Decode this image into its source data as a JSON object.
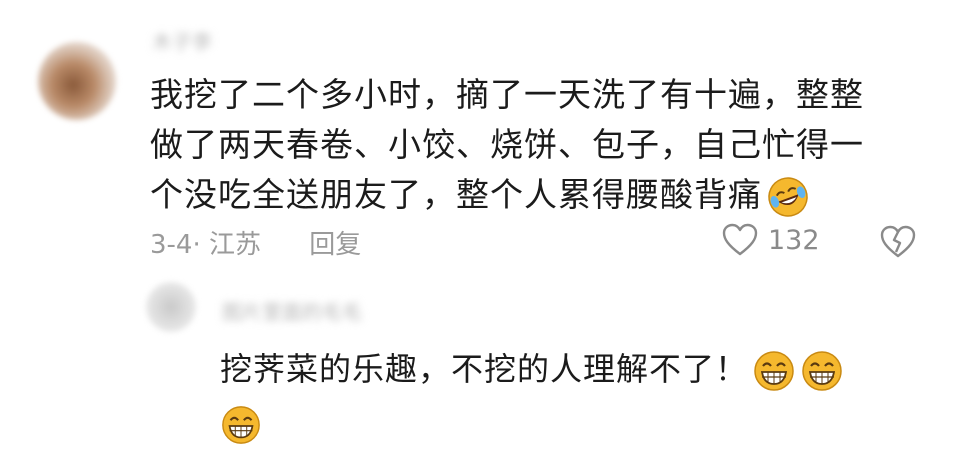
{
  "comment": {
    "author_name": "木子李",
    "text_lines": [
      "我挖了二个多小时，摘了一天洗了有十遍，整整",
      "做了两天春卷、小饺、烧饼、包子，自己忙得一",
      "个没吃全送朋友了，整个人累得腰酸背痛"
    ],
    "trailing_emoji": "laughing-tears-emoji",
    "date_location": "3-4· 江苏",
    "reply_label": "回复",
    "like_count": "132"
  },
  "reply": {
    "author_name": "图片里面的毛毛",
    "text_line1": "挖荠菜的乐趣，不挖的人理解不了！",
    "emojis": [
      "grinning-emoji",
      "grinning-emoji",
      "grinning-emoji"
    ]
  },
  "colors": {
    "text": "#1b1b1b",
    "meta": "#9a9a9a",
    "emoji_yellow": "#f5b82e"
  }
}
